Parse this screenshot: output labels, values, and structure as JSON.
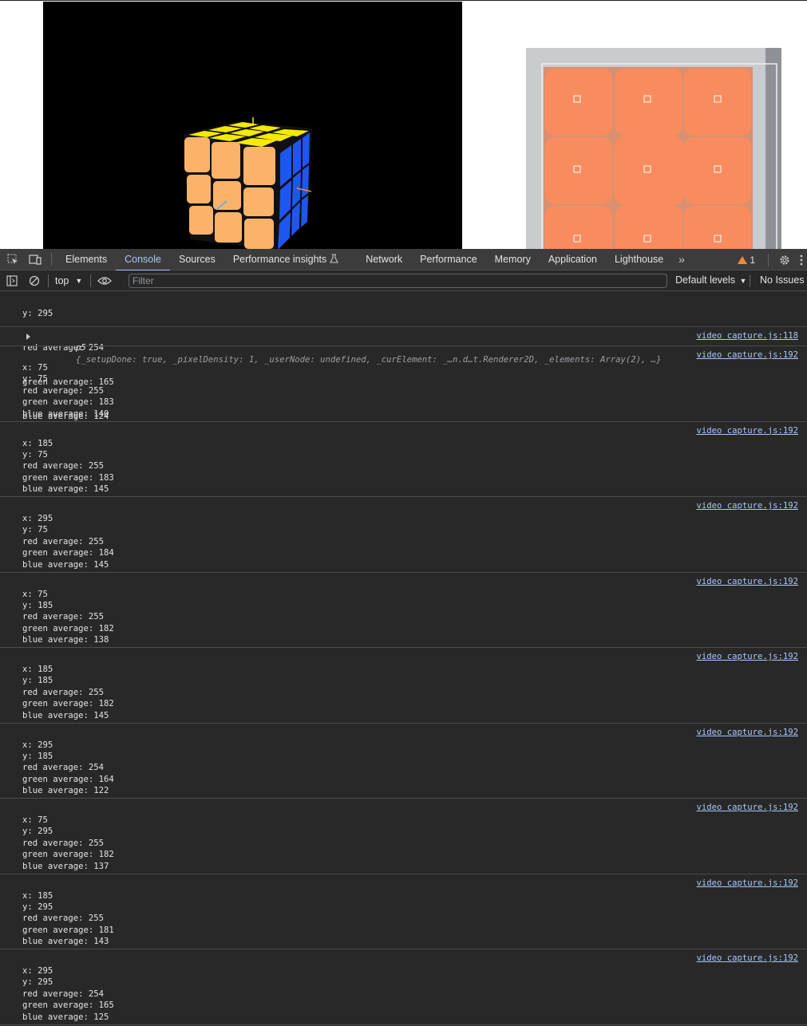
{
  "devtools": {
    "tabs": [
      "Elements",
      "Console",
      "Sources",
      "Performance insights",
      "Network",
      "Performance",
      "Memory",
      "Application",
      "Lighthouse"
    ],
    "active_tab": "Console",
    "warning_count": "1",
    "context": "top",
    "filter_placeholder": "Filter",
    "levels_label": "Default levels",
    "issues_label": "No Issues"
  },
  "console": {
    "first_partial": {
      "lines": [
        "y: 295",
        "red average: 254",
        "green average: 165",
        "blue average: 124"
      ]
    },
    "object_log": {
      "name": "p5",
      "preview": "{_setupDone: true, _pixelDensity: 1, _userNode: undefined, _curElement: _…n.d…t.Renderer2D, _elements: Array(2), …}",
      "source": "video capture.js:118"
    },
    "logs": [
      {
        "source": "video capture.js:192",
        "x": "75",
        "y": "75",
        "red": "255",
        "green": "183",
        "blue": "140"
      },
      {
        "source": "video capture.js:192",
        "x": "185",
        "y": "75",
        "red": "255",
        "green": "183",
        "blue": "145"
      },
      {
        "source": "video capture.js:192",
        "x": "295",
        "y": "75",
        "red": "255",
        "green": "184",
        "blue": "145"
      },
      {
        "source": "video capture.js:192",
        "x": "75",
        "y": "185",
        "red": "255",
        "green": "182",
        "blue": "138"
      },
      {
        "source": "video capture.js:192",
        "x": "185",
        "y": "185",
        "red": "255",
        "green": "182",
        "blue": "145"
      },
      {
        "source": "video capture.js:192",
        "x": "295",
        "y": "185",
        "red": "254",
        "green": "164",
        "blue": "122"
      },
      {
        "source": "video capture.js:192",
        "x": "75",
        "y": "295",
        "red": "255",
        "green": "182",
        "blue": "137"
      },
      {
        "source": "video capture.js:192",
        "x": "185",
        "y": "295",
        "red": "255",
        "green": "181",
        "blue": "143"
      },
      {
        "source": "video capture.js:192",
        "x": "295",
        "y": "295",
        "red": "254",
        "green": "165",
        "blue": "125"
      }
    ]
  },
  "colors": {
    "cube_yellow": "#f5e900",
    "cube_orange": "#fbb36a",
    "cube_blue": "#1e56f0",
    "camera_orange": "#f98c5e",
    "devtools_bg": "#282828",
    "link_blue": "#a8c7fa"
  }
}
